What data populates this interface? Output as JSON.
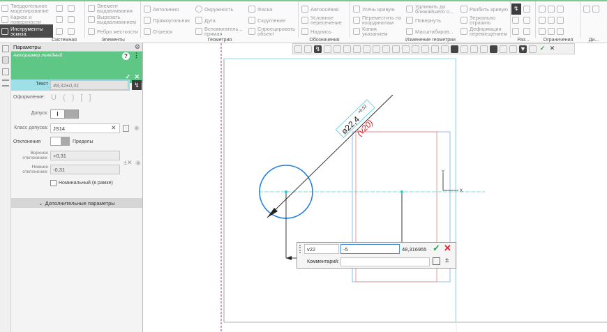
{
  "ribbon": {
    "groups": [
      {
        "label": "Системная",
        "items": [
          "Твердотельное моделирование",
          "Каркас и поверхности",
          "Инструменты эскиза"
        ]
      },
      {
        "label": "Элементы",
        "items": [
          "Элемент выдавливания",
          "Вырезать выдавливанием",
          "Ребро жесткости"
        ]
      },
      {
        "label": "Геометрия",
        "items": [
          "Автолиния",
          "Прямоугольник",
          "Отрезок",
          "Окружность",
          "Дуга",
          "Вспомогатель... прямая",
          "Фаска",
          "Скругление",
          "Спроецировать объект"
        ]
      },
      {
        "label": "Обозначения",
        "items": [
          "Автоосевая",
          "Условное пересечение",
          "Надпись"
        ]
      },
      {
        "label": "Изменение геометрии",
        "items": [
          "Усечь кривую",
          "Переместить по координатам",
          "Копия указанием",
          "Удлинить до ближайшего о...",
          "Повернуть",
          "Масштабиров...",
          "Разбить кривую",
          "Зеркально отразить",
          "Деформация перемещением"
        ]
      },
      {
        "label": "Раз...",
        "items": []
      },
      {
        "label": "Ограничения",
        "items": []
      },
      {
        "label": "Ди...",
        "items": []
      }
    ]
  },
  "panel": {
    "title": "Параметры",
    "command": "Авторазмер линейный",
    "text_label": "Текст",
    "text_value": "48,32±0,31",
    "format_label": "Оформление:",
    "format_symbols": "U ( ) [ ]",
    "tolerance_label": "Допуск:",
    "tolerance_toggle": "I",
    "fit_class_label": "Класс допуска:",
    "fit_class_value": "JS14",
    "deviations_label": "Отклонения",
    "limits_label": "Пределы",
    "upper_label": "Верхнее отклонение:",
    "upper_value": "+0,31",
    "lower_label": "Нижнее отклонение:",
    "lower_value": "-0,31",
    "nominal_framed": "Номинальный (в рамке)",
    "additional": "Дополнительные параметры"
  },
  "drawing": {
    "diameter_text": "ø22,4",
    "diameter_tol": "+0,52",
    "variable_text": "(v20)",
    "axis_x": "X",
    "axis_y": "Y"
  },
  "popup": {
    "var_name": "v22",
    "expression": "-5",
    "value": "48,316955",
    "comment_label": "Комментарий:",
    "comment_value": ""
  },
  "colors": {
    "accent_green": "#5ec786",
    "circle_blue": "#1f7de0",
    "dim_red": "#e0202a",
    "ok_green": "#2aa24a"
  }
}
